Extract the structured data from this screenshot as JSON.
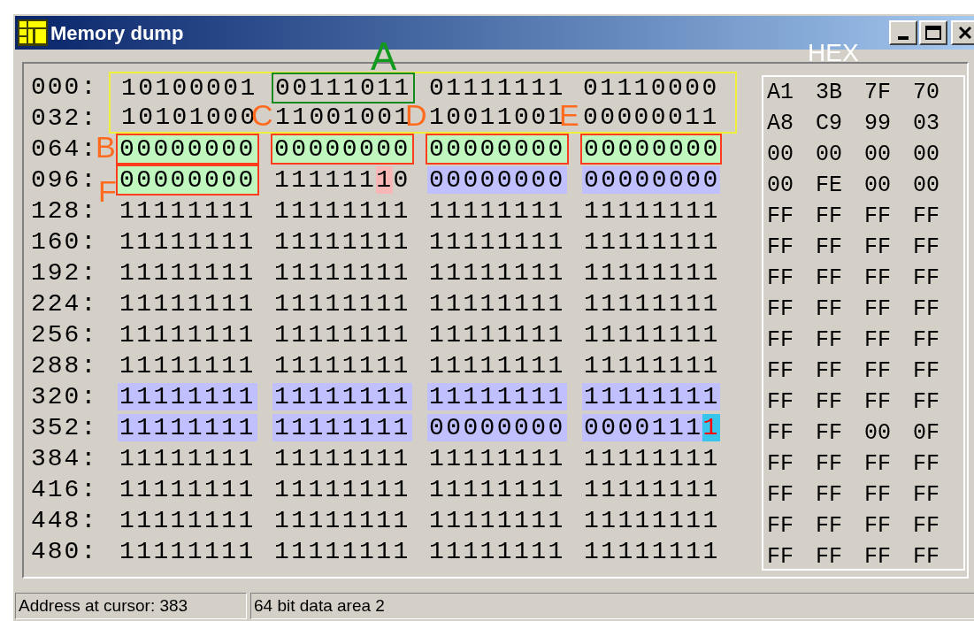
{
  "window": {
    "title": "Memory dump"
  },
  "hex_label": "HEX",
  "rows": [
    {
      "address": "000:",
      "framed": true,
      "bytes": [
        {
          "kind": "plain",
          "bits": "10100001"
        },
        {
          "kind": "outlined",
          "bits": "00111011",
          "callout": {
            "text": "A",
            "kind": "above",
            "color": "#129a1e"
          }
        },
        {
          "kind": "plain",
          "bits": "01111111"
        },
        {
          "kind": "plain",
          "bits": "01110000"
        }
      ],
      "hex": [
        "A1",
        "3B",
        "7F",
        "70"
      ]
    },
    {
      "address": "032:",
      "framed": true,
      "bytes": [
        {
          "kind": "plain",
          "bits": "10101000"
        },
        {
          "kind": "plain",
          "bits": "11001001",
          "callout": {
            "text": "C",
            "kind": "beside",
            "color": "#ff6a1e"
          }
        },
        {
          "kind": "plain",
          "bits": "10011001",
          "callout": {
            "text": "D",
            "kind": "beside",
            "color": "#ff6a1e"
          }
        },
        {
          "kind": "plain",
          "bits": "00000011",
          "callout": {
            "text": "E",
            "kind": "beside",
            "color": "#ff6a1e"
          }
        }
      ],
      "hex": [
        "A8",
        "C9",
        "99",
        "03"
      ]
    },
    {
      "address": "064:",
      "framed": false,
      "bytes": [
        {
          "kind": "selected",
          "bits": "00000000",
          "callout": {
            "text": "B",
            "kind": "beside",
            "color": "#ff6a1e"
          }
        },
        {
          "kind": "selected",
          "bits": "00000000"
        },
        {
          "kind": "selected",
          "bits": "00000000"
        },
        {
          "kind": "selected",
          "bits": "00000000"
        }
      ],
      "hex": [
        "00",
        "00",
        "00",
        "00"
      ]
    },
    {
      "address": "096:",
      "framed": false,
      "bytes": [
        {
          "kind": "selected",
          "bits": "00000000",
          "callout": {
            "text": "F",
            "kind": "below",
            "color": "#ff6a1e"
          }
        },
        {
          "kind": "plain",
          "segments": [
            {
              "kind": "plain",
              "text": "111111"
            },
            {
              "kind": "flagged",
              "text": "1"
            },
            {
              "kind": "plain",
              "text": "0"
            }
          ]
        },
        {
          "kind": "shaded",
          "bits": "00000000"
        },
        {
          "kind": "shaded",
          "bits": "00000000"
        }
      ],
      "hex": [
        "00",
        "FE",
        "00",
        "00"
      ]
    },
    {
      "address": "128:",
      "framed": false,
      "bytes": [
        {
          "kind": "plain",
          "bits": "11111111"
        },
        {
          "kind": "plain",
          "bits": "11111111"
        },
        {
          "kind": "plain",
          "bits": "11111111"
        },
        {
          "kind": "plain",
          "bits": "11111111"
        }
      ],
      "hex": [
        "FF",
        "FF",
        "FF",
        "FF"
      ]
    },
    {
      "address": "160:",
      "framed": false,
      "bytes": [
        {
          "kind": "plain",
          "bits": "11111111"
        },
        {
          "kind": "plain",
          "bits": "11111111"
        },
        {
          "kind": "plain",
          "bits": "11111111"
        },
        {
          "kind": "plain",
          "bits": "11111111"
        }
      ],
      "hex": [
        "FF",
        "FF",
        "FF",
        "FF"
      ]
    },
    {
      "address": "192:",
      "framed": false,
      "bytes": [
        {
          "kind": "plain",
          "bits": "11111111"
        },
        {
          "kind": "plain",
          "bits": "11111111"
        },
        {
          "kind": "plain",
          "bits": "11111111"
        },
        {
          "kind": "plain",
          "bits": "11111111"
        }
      ],
      "hex": [
        "FF",
        "FF",
        "FF",
        "FF"
      ]
    },
    {
      "address": "224:",
      "framed": false,
      "bytes": [
        {
          "kind": "plain",
          "bits": "11111111"
        },
        {
          "kind": "plain",
          "bits": "11111111"
        },
        {
          "kind": "plain",
          "bits": "11111111"
        },
        {
          "kind": "plain",
          "bits": "11111111"
        }
      ],
      "hex": [
        "FF",
        "FF",
        "FF",
        "FF"
      ]
    },
    {
      "address": "256:",
      "framed": false,
      "bytes": [
        {
          "kind": "plain",
          "bits": "11111111"
        },
        {
          "kind": "plain",
          "bits": "11111111"
        },
        {
          "kind": "plain",
          "bits": "11111111"
        },
        {
          "kind": "plain",
          "bits": "11111111"
        }
      ],
      "hex": [
        "FF",
        "FF",
        "FF",
        "FF"
      ]
    },
    {
      "address": "288:",
      "framed": false,
      "bytes": [
        {
          "kind": "plain",
          "bits": "11111111"
        },
        {
          "kind": "plain",
          "bits": "11111111"
        },
        {
          "kind": "plain",
          "bits": "11111111"
        },
        {
          "kind": "plain",
          "bits": "11111111"
        }
      ],
      "hex": [
        "FF",
        "FF",
        "FF",
        "FF"
      ]
    },
    {
      "address": "320:",
      "framed": false,
      "bytes": [
        {
          "kind": "shaded",
          "bits": "11111111"
        },
        {
          "kind": "shaded",
          "bits": "11111111"
        },
        {
          "kind": "shaded",
          "bits": "11111111"
        },
        {
          "kind": "shaded",
          "bits": "11111111"
        }
      ],
      "hex": [
        "FF",
        "FF",
        "FF",
        "FF"
      ]
    },
    {
      "address": "352:",
      "framed": false,
      "bytes": [
        {
          "kind": "shaded",
          "bits": "11111111"
        },
        {
          "kind": "shaded",
          "bits": "11111111"
        },
        {
          "kind": "shaded",
          "bits": "00000000"
        },
        {
          "kind": "shaded",
          "segments": [
            {
              "kind": "plain",
              "text": "0000111"
            },
            {
              "kind": "cursor",
              "text": "1"
            }
          ]
        }
      ],
      "hex": [
        "FF",
        "FF",
        "00",
        "0F"
      ]
    },
    {
      "address": "384:",
      "framed": false,
      "bytes": [
        {
          "kind": "plain",
          "bits": "11111111"
        },
        {
          "kind": "plain",
          "bits": "11111111"
        },
        {
          "kind": "plain",
          "bits": "11111111"
        },
        {
          "kind": "plain",
          "bits": "11111111"
        }
      ],
      "hex": [
        "FF",
        "FF",
        "FF",
        "FF"
      ]
    },
    {
      "address": "416:",
      "framed": false,
      "bytes": [
        {
          "kind": "plain",
          "bits": "11111111"
        },
        {
          "kind": "plain",
          "bits": "11111111"
        },
        {
          "kind": "plain",
          "bits": "11111111"
        },
        {
          "kind": "plain",
          "bits": "11111111"
        }
      ],
      "hex": [
        "FF",
        "FF",
        "FF",
        "FF"
      ]
    },
    {
      "address": "448:",
      "framed": false,
      "bytes": [
        {
          "kind": "plain",
          "bits": "11111111"
        },
        {
          "kind": "plain",
          "bits": "11111111"
        },
        {
          "kind": "plain",
          "bits": "11111111"
        },
        {
          "kind": "plain",
          "bits": "11111111"
        }
      ],
      "hex": [
        "FF",
        "FF",
        "FF",
        "FF"
      ]
    },
    {
      "address": "480:",
      "framed": false,
      "bytes": [
        {
          "kind": "plain",
          "bits": "11111111"
        },
        {
          "kind": "plain",
          "bits": "11111111"
        },
        {
          "kind": "plain",
          "bits": "11111111"
        },
        {
          "kind": "plain",
          "bits": "11111111"
        }
      ],
      "hex": [
        "FF",
        "FF",
        "FF",
        "FF"
      ]
    }
  ],
  "status_bar": [
    "Address at cursor: 383",
    "64 bit data area 2"
  ]
}
